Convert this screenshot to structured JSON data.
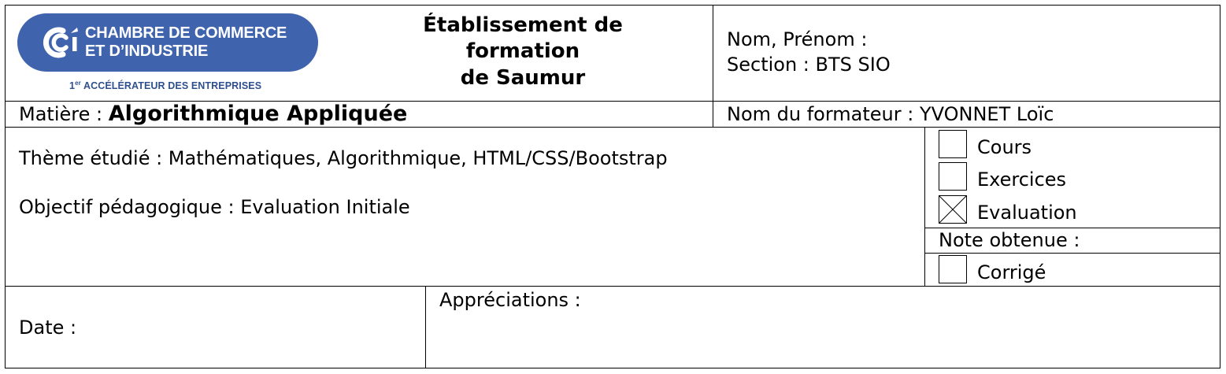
{
  "logo": {
    "line1": "CHAMBRE DE COMMERCE",
    "line2": "ET D’INDUSTRIE",
    "tagline_number": "1",
    "tagline_superscript": "er",
    "tagline": "ACCÉLÉRATEUR DES ENTREPRISES",
    "brand_color": "#3f64ad"
  },
  "header": {
    "title_line1": "Établissement de",
    "title_line2": "formation",
    "title_line3": "de Saumur",
    "name_label": "Nom, Prénom :",
    "section_label": "Section : BTS SIO"
  },
  "subject": {
    "label": "Matière :",
    "value": "Algorithmique Appliquée",
    "trainer": "Nom du formateur : YVONNET Loïc"
  },
  "theme": {
    "studied": "Thème étudié : Mathématiques, Algorithmique, HTML/CSS/Bootstrap",
    "objective": "Objectif pédagogique : Evaluation Initiale"
  },
  "doc_types": [
    {
      "label": "Cours",
      "checked": false
    },
    {
      "label": "Exercices",
      "checked": false
    },
    {
      "label": "Evaluation",
      "checked": true
    }
  ],
  "grade_label": "Note obtenue :",
  "corrige": {
    "label": "Corrigé",
    "checked": false
  },
  "footer": {
    "date_label": "Date :",
    "appreciations_label": "Appréciations :"
  }
}
